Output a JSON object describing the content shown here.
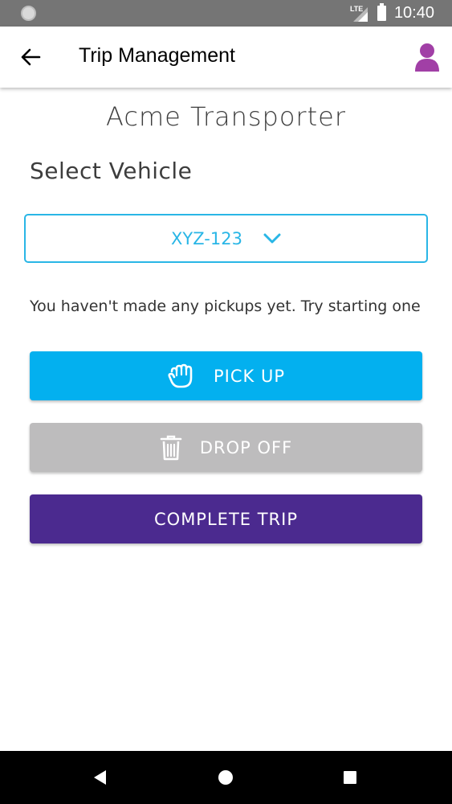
{
  "status_bar": {
    "network_label": "LTE",
    "time": "10:40"
  },
  "app_bar": {
    "title": "Trip Management",
    "back_icon": "arrow-left-icon",
    "profile_icon": "person-icon",
    "profile_color": "#a13fa6"
  },
  "main": {
    "company_name": "Acme Transporter",
    "select_label": "Select Vehicle",
    "vehicle_selected": "XYZ-123",
    "empty_message": "You haven't made any pickups yet. Try starting one"
  },
  "actions": {
    "pickup_label": "PICK UP",
    "pickup_icon": "hand-grab-icon",
    "pickup_color": "#03b0ef",
    "dropoff_label": "DROP OFF",
    "dropoff_icon": "trash-icon",
    "dropoff_color": "#bdbcbd",
    "complete_label": "COMPLETE TRIP",
    "complete_color": "#4b2a8f"
  },
  "colors": {
    "accent": "#29b6e6"
  }
}
